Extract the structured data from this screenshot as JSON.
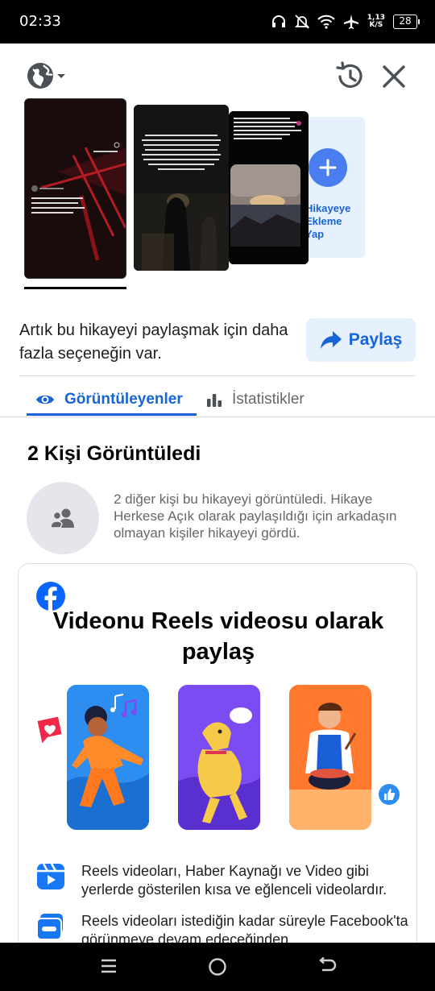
{
  "status_bar": {
    "time": "02:33",
    "net_speed_value": "1,13",
    "net_speed_unit": "K/S",
    "battery": "28"
  },
  "toolbar": {
    "privacy_icon": "globe-icon",
    "history_icon": "history-icon",
    "close_icon": "close-icon"
  },
  "story_thumbnails": {
    "add_button_label": "Hikayeye Ekleme Yap"
  },
  "share": {
    "description": "Artık bu hikayeyi paylaşmak için daha fazla seçeneğin var.",
    "button_label": "Paylaş",
    "accent": "#1665d8",
    "button_bg": "#e7f0fd"
  },
  "tabs": [
    {
      "label": "Görüntüleyenler",
      "icon": "eye-icon",
      "active": true
    },
    {
      "label": "İstatistikler",
      "icon": "bar-chart-icon",
      "active": false
    }
  ],
  "viewers": {
    "title": "2 Kişi Görüntüledi",
    "description": "2 diğer kişi bu hikayeyi görüntüledi. Hikaye Herkese Açık olarak paylaşıldığı için arkadaşın olmayan kişiler hikayeyi gördü."
  },
  "reels_card": {
    "title": "Videonu Reels videosu olarak paylaş",
    "features": [
      {
        "icon": "reels-icon",
        "text": "Reels videoları, Haber Kaynağı ve Video gibi yerlerde gösterilen kısa ve eğlenceli videolardır."
      },
      {
        "icon": "reels-duration-icon",
        "text": "Reels videoları istediğin kadar süreyle Facebook'ta görünmeye devam edeceğinden"
      }
    ]
  },
  "nav_bar": {
    "items": [
      "menu-icon",
      "home-icon",
      "back-icon"
    ]
  }
}
